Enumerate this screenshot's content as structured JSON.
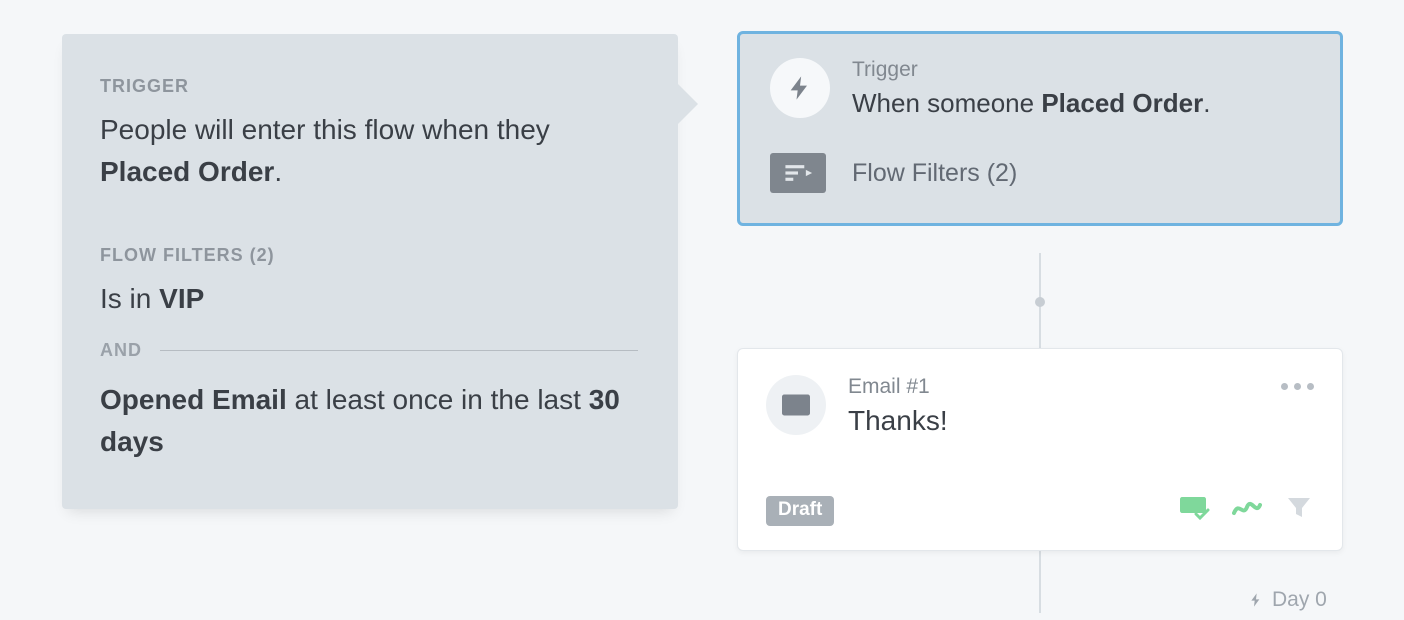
{
  "details": {
    "trigger_label": "TRIGGER",
    "trigger_prefix": "People will enter this flow when they ",
    "trigger_event": "Placed Order",
    "trigger_suffix": ".",
    "filters_label_prefix": "FLOW FILTERS (",
    "filters_count": "2",
    "filters_label_suffix": ")",
    "filter1_prefix": "Is in ",
    "filter1_value": "VIP",
    "and_text": "AND",
    "filter2_bold1": "Opened Email",
    "filter2_mid": " at least once in the last ",
    "filter2_bold2": "30 days"
  },
  "trigger_card": {
    "mini_label": "Trigger",
    "sentence_prefix": "When someone ",
    "sentence_event": "Placed Order",
    "sentence_suffix": ".",
    "filters_label": "Flow Filters (2)"
  },
  "email_card": {
    "mini_label": "Email #1",
    "title": "Thanks!",
    "badge": "Draft"
  },
  "day_marker": "Day 0"
}
